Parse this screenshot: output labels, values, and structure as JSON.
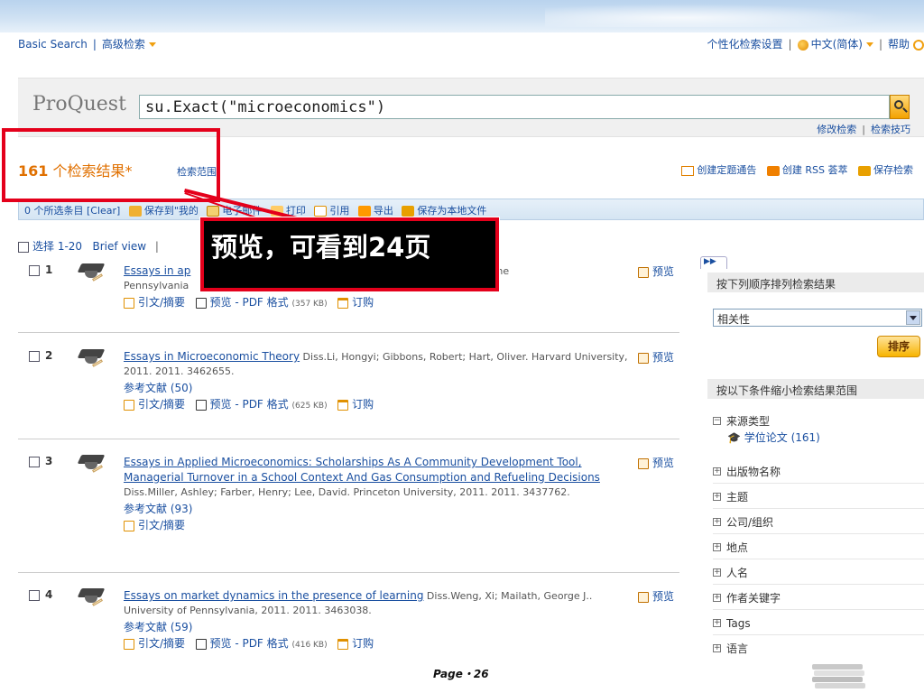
{
  "topbar": {
    "basic_search": "Basic Search",
    "advanced_search": "高级检索",
    "personalize": "个性化检索设置",
    "language": "中文(简体)",
    "help": "帮助"
  },
  "search": {
    "logo": "ProQuest",
    "query": "su.Exact(\"microeconomics\")",
    "modify": "修改检索",
    "tips": "检索技巧"
  },
  "results_header": {
    "count_num": "161",
    "count_label": "个检索结果*",
    "scope": "检索范围",
    "create_alert": "创建定题通告",
    "create_rss": "创建 RSS 荟萃",
    "save_search": "保存检索"
  },
  "toolbar": {
    "selected": "0 个所选条目",
    "clear": "[Clear]",
    "save_to": "保存到\"我的",
    "email": "电子邮件",
    "print": "打印",
    "cite": "引用",
    "export": "导出",
    "save_local": "保存为本地文件"
  },
  "selection_row": {
    "select": "选择 1-20",
    "brief_view": "Brief view"
  },
  "results": [
    {
      "num": "1",
      "title": "Essays in ap",
      "meta_tail": "a, Kala. The",
      "meta_line2": "Pennsylvania",
      "refs": "",
      "links": [
        "引文/摘要",
        "预览 - PDF 格式",
        "(357 KB)",
        "订购"
      ],
      "preview": "预览"
    },
    {
      "num": "2",
      "title": "Essays in Microeconomic Theory",
      "meta": " Diss.Li, Hongyi; Gibbons, Robert; Hart, Oliver. Harvard University, 2011. 2011. 3462655.",
      "refs": "参考文献 (50)",
      "links": [
        "引文/摘要",
        "预览 - PDF 格式",
        "(625 KB)",
        "订购"
      ],
      "preview": "预览"
    },
    {
      "num": "3",
      "title": "Essays in Applied Microeconomics: Scholarships As A Community Development Tool, Managerial Turnover in a School Context And Gas Consumption and Refueling Decisions",
      "meta": " Diss.Miller, Ashley; Farber, Henry; Lee, David. Princeton University, 2011. 2011. 3437762.",
      "refs": "参考文献 (93)",
      "links": [
        "引文/摘要"
      ],
      "preview": "预览"
    },
    {
      "num": "4",
      "title": "Essays on market dynamics in the presence of learning",
      "meta": " Diss.Weng, Xi; Mailath, George J.. University of Pennsylvania, 2011. 2011. 3463038.",
      "refs": "参考文献 (59)",
      "links": [
        "引文/摘要",
        "预览 - PDF 格式",
        "(416 KB)",
        "订购"
      ],
      "preview": "预览"
    }
  ],
  "sidebar": {
    "sort_heading": "按下列顺序排列检索结果",
    "sort_value": "相关性",
    "sort_button": "排序",
    "narrow_heading": "按以下条件缩小检索结果范围",
    "source_type": "来源类型",
    "source_sub": "学位论文 (161)",
    "facets": [
      "出版物名称",
      "主题",
      "公司/组织",
      "地点",
      "人名",
      "作者关键字",
      "Tags",
      "语言"
    ]
  },
  "callout": {
    "text": "预览，可看到24页"
  },
  "footer": {
    "page": "Page・26"
  },
  "colors": {
    "callout_red": "#e4001b",
    "link_blue": "#1a4fa0",
    "count_orange": "#e07000"
  }
}
